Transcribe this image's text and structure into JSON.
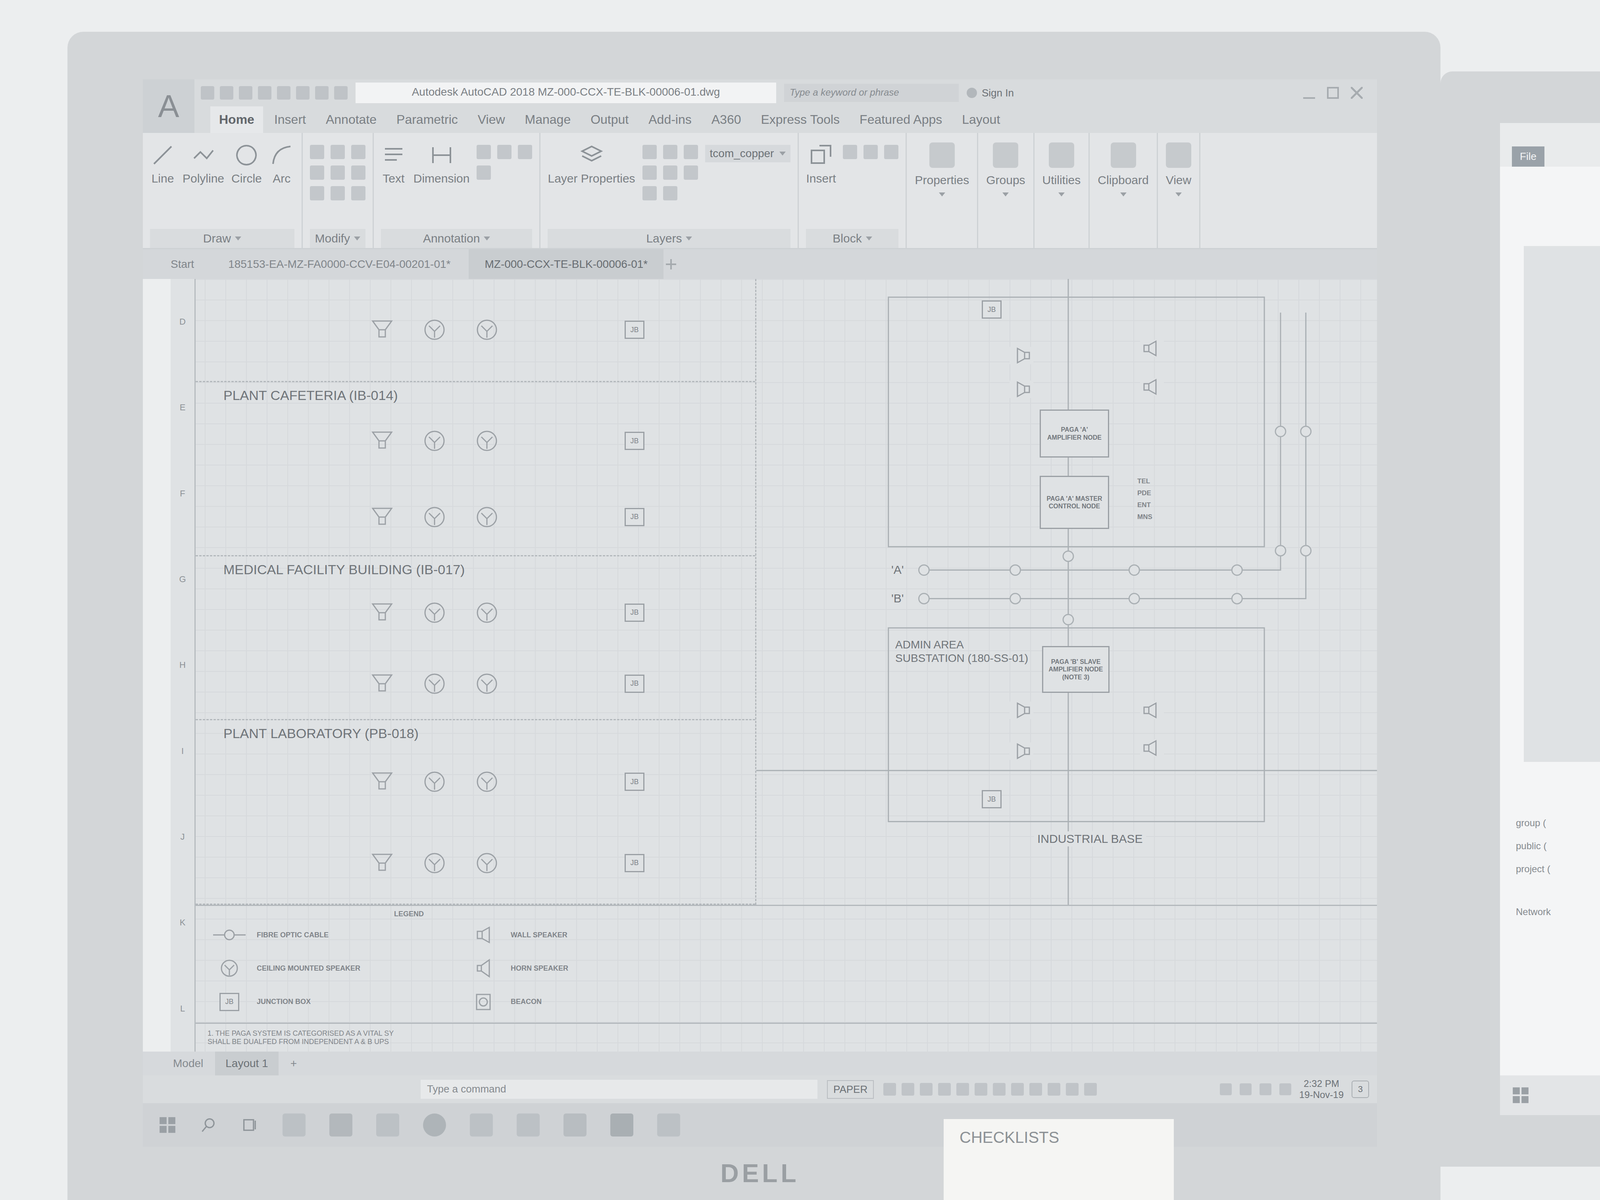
{
  "app_button": "A",
  "window": {
    "title": "Autodesk AutoCAD 2018   MZ-000-CCX-TE-BLK-00006-01.dwg"
  },
  "search": {
    "placeholder": "Type a keyword or phrase"
  },
  "account": {
    "label": "Sign In"
  },
  "ribbon_tabs": [
    {
      "label": "Home",
      "selected": true
    },
    {
      "label": "Insert",
      "selected": false
    },
    {
      "label": "Annotate",
      "selected": false
    },
    {
      "label": "Parametric",
      "selected": false
    },
    {
      "label": "View",
      "selected": false
    },
    {
      "label": "Manage",
      "selected": false
    },
    {
      "label": "Output",
      "selected": false
    },
    {
      "label": "Add-ins",
      "selected": false
    },
    {
      "label": "A360",
      "selected": false
    },
    {
      "label": "Express Tools",
      "selected": false
    },
    {
      "label": "Featured Apps",
      "selected": false
    },
    {
      "label": "Layout",
      "selected": false
    }
  ],
  "ribbon_panels": [
    {
      "title": "Draw",
      "tools": [
        "Line",
        "Polyline",
        "Circle",
        "Arc"
      ]
    },
    {
      "title": "Modify",
      "tools": []
    },
    {
      "title": "Annotation",
      "tools": [
        "Text",
        "Dimension"
      ]
    },
    {
      "title": "Layers",
      "tools": [
        "Layer Properties"
      ],
      "layer": "tcom_copper"
    },
    {
      "title": "Block",
      "tools": [
        "Insert"
      ]
    }
  ],
  "collapsed_panels": [
    "Properties",
    "Groups",
    "Utilities",
    "Clipboard",
    "View"
  ],
  "file_tabs": [
    {
      "label": "Start",
      "selected": false
    },
    {
      "label": "185153-EA-MZ-FA0000-CCV-E04-00201-01*",
      "selected": false
    },
    {
      "label": "MZ-000-CCX-TE-BLK-00006-01*",
      "selected": true
    }
  ],
  "ruler": [
    "D",
    "E",
    "F",
    "G",
    "H",
    "I",
    "J",
    "K",
    "L"
  ],
  "sections": [
    {
      "title": "",
      "rows": [
        {
          "box": "JB"
        }
      ]
    },
    {
      "title": "PLANT CAFETERIA (IB-014)",
      "rows": [
        {
          "box": "JB"
        },
        {
          "box": "JB"
        }
      ]
    },
    {
      "title": "MEDICAL FACILITY BUILDING (IB-017)",
      "rows": [
        {
          "box": "JB"
        },
        {
          "box": "JB"
        }
      ]
    },
    {
      "title": "PLANT LABORATORY (PB-018)",
      "rows": [
        {
          "box": "JB"
        },
        {
          "box": "JB"
        }
      ]
    }
  ],
  "diagram": {
    "top_jb": "JB",
    "amplifier": "PAGA 'A' AMPLIFIER NODE",
    "master": "PAGA 'A' MASTER CONTROL NODE",
    "interfaces": [
      "TEL",
      "PDE",
      "ENT",
      "MNS"
    ],
    "buses": [
      "'A'",
      "'B'"
    ],
    "substation": "ADMIN AREA SUBSTATION (180-SS-01)",
    "slave": "PAGA 'B' SLAVE AMPLIFIER NODE (NOTE 3)",
    "bottom_jb": "JB",
    "area": "INDUSTRIAL BASE"
  },
  "legend": {
    "title": "LEGEND",
    "items": [
      {
        "kind": "cable",
        "label": "FIBRE OPTIC CABLE"
      },
      {
        "kind": "ceiling",
        "label": "CEILING MOUNTED SPEAKER"
      },
      {
        "kind": "jb",
        "label": "JUNCTION BOX",
        "box": "JB"
      },
      {
        "kind": "wall",
        "label": "WALL SPEAKER"
      },
      {
        "kind": "horn",
        "label": "HORN SPEAKER"
      },
      {
        "kind": "beacon",
        "label": "BEACON"
      }
    ]
  },
  "notes": [
    "1. THE PAGA SYSTEM IS CATEGORISED AS A VITAL SY",
    "SHALL BE DUALFED FROM INDEPENDENT A & B UPS"
  ],
  "layout_tabs": [
    {
      "label": "Model",
      "selected": false
    },
    {
      "label": "Layout 1",
      "selected": true
    }
  ],
  "layout_add": "+",
  "command": {
    "placeholder": "Type a command"
  },
  "status": {
    "space": "PAPER"
  },
  "tray": {
    "time": "2:32 PM",
    "date": "19-Nov-19",
    "notifications": "3"
  },
  "monitor": {
    "brand": "DELL"
  },
  "note": {
    "text": "CHECKLISTS"
  },
  "second_screen": {
    "tab": "File",
    "items": [
      "group (",
      "public (",
      "project ("
    ],
    "network": "Network"
  }
}
